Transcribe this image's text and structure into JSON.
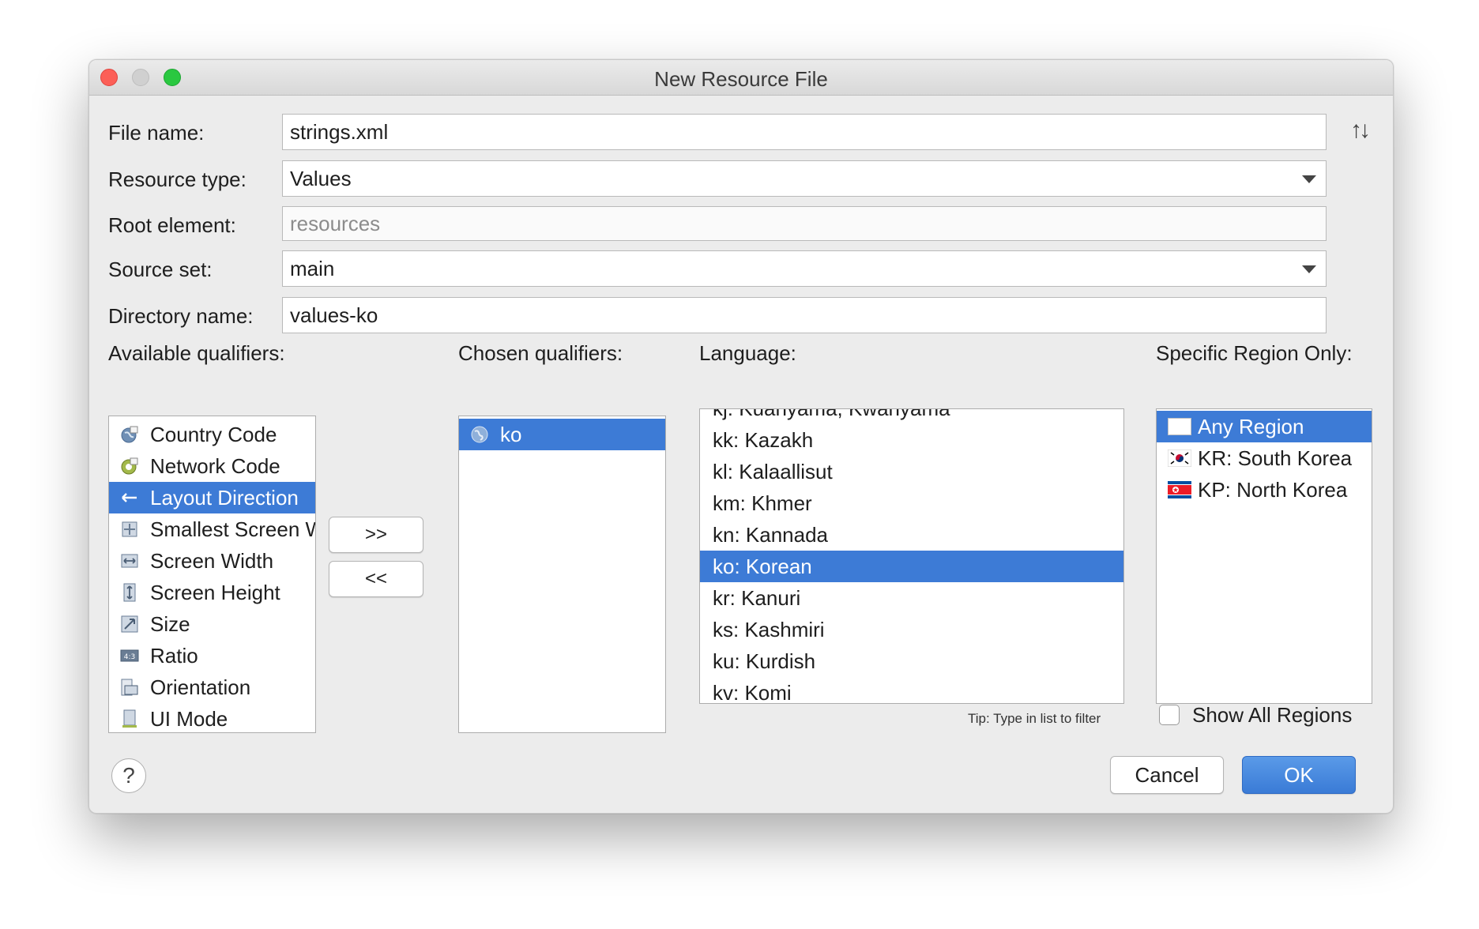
{
  "window": {
    "title": "New Resource File"
  },
  "form": {
    "file_name_label": "File name:",
    "file_name_value": "strings.xml",
    "resource_type_label": "Resource type:",
    "resource_type_value": "Values",
    "root_element_label": "Root element:",
    "root_element_value": "resources",
    "source_set_label": "Source set:",
    "source_set_value": "main",
    "directory_name_label": "Directory name:",
    "directory_name_value": "values-ko"
  },
  "available": {
    "label": "Available qualifiers:",
    "items": [
      {
        "label": "Country Code",
        "icon": "country-code-icon",
        "selected": false
      },
      {
        "label": "Network Code",
        "icon": "network-code-icon",
        "selected": false
      },
      {
        "label": "Layout Direction",
        "icon": "layout-direction-icon",
        "selected": true
      },
      {
        "label": "Smallest Screen Width",
        "icon": "smallest-screen-icon",
        "selected": false
      },
      {
        "label": "Screen Width",
        "icon": "screen-width-icon",
        "selected": false
      },
      {
        "label": "Screen Height",
        "icon": "screen-height-icon",
        "selected": false
      },
      {
        "label": "Size",
        "icon": "size-icon",
        "selected": false
      },
      {
        "label": "Ratio",
        "icon": "ratio-icon",
        "selected": false
      },
      {
        "label": "Orientation",
        "icon": "orientation-icon",
        "selected": false
      },
      {
        "label": "UI Mode",
        "icon": "ui-mode-icon",
        "selected": false
      }
    ]
  },
  "transfer": {
    "add": ">>",
    "remove": "<<"
  },
  "chosen": {
    "label": "Chosen qualifiers:",
    "items": [
      {
        "label": "ko",
        "icon": "globe-icon",
        "selected": true
      }
    ]
  },
  "language": {
    "label": "Language:",
    "items": [
      {
        "label": "kj: Kuanyama, Kwanyama",
        "selected": false
      },
      {
        "label": "kk: Kazakh",
        "selected": false
      },
      {
        "label": "kl: Kalaallisut",
        "selected": false
      },
      {
        "label": "km: Khmer",
        "selected": false
      },
      {
        "label": "kn: Kannada",
        "selected": false
      },
      {
        "label": "ko: Korean",
        "selected": true
      },
      {
        "label": "kr: Kanuri",
        "selected": false
      },
      {
        "label": "ks: Kashmiri",
        "selected": false
      },
      {
        "label": "ku: Kurdish",
        "selected": false
      },
      {
        "label": "kv: Komi",
        "selected": false
      }
    ],
    "tip": "Tip: Type in list to filter"
  },
  "region": {
    "label": "Specific Region Only:",
    "items": [
      {
        "label": "Any Region",
        "flag": "blank-flag-icon",
        "selected": true
      },
      {
        "label": "KR: South Korea",
        "flag": "south-korea-flag-icon",
        "selected": false
      },
      {
        "label": "KP: North Korea",
        "flag": "north-korea-flag-icon",
        "selected": false
      }
    ],
    "show_all_label": "Show All Regions",
    "show_all_checked": false
  },
  "buttons": {
    "help": "?",
    "cancel": "Cancel",
    "ok": "OK"
  },
  "colors": {
    "selection": "#3d7bd6",
    "ok_button": "#3a7bd6"
  }
}
